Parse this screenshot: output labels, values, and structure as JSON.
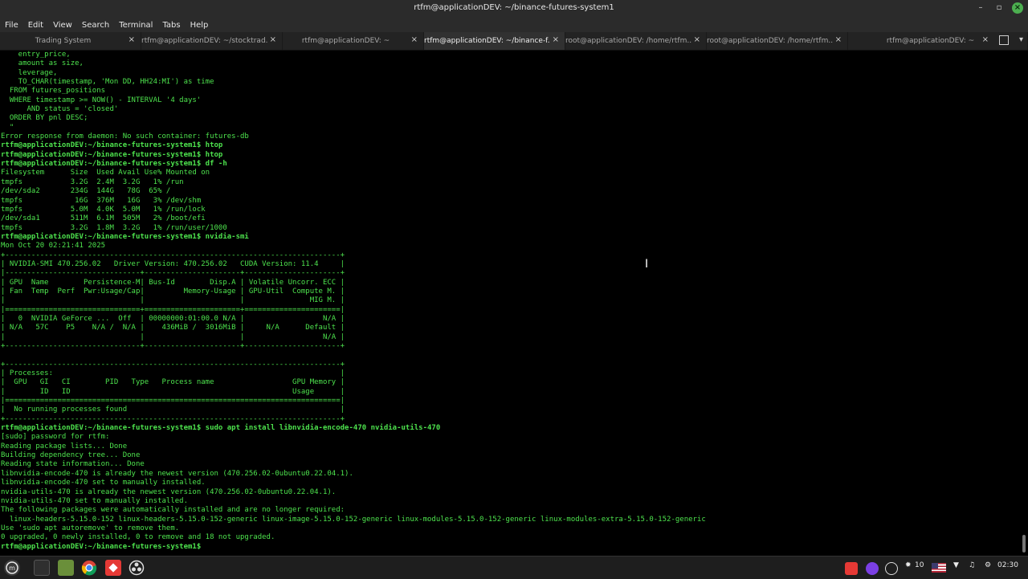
{
  "window": {
    "title": "rtfm@applicationDEV: ~/binance-futures-system1"
  },
  "menu": [
    "File",
    "Edit",
    "View",
    "Search",
    "Terminal",
    "Tabs",
    "Help"
  ],
  "tabs": [
    {
      "label": "Trading System",
      "active": false
    },
    {
      "label": "rtfm@applicationDEV: ~/stocktrad...",
      "active": false
    },
    {
      "label": "rtfm@applicationDEV: ~",
      "active": false
    },
    {
      "label": "rtfm@applicationDEV: ~/binance-f...",
      "active": true
    },
    {
      "label": "root@applicationDEV: /home/rtfm...",
      "active": false
    },
    {
      "label": "root@applicationDEV: /home/rtfm...",
      "active": false
    },
    {
      "label": "rtfm@applicationDEV: ~",
      "active": false
    }
  ],
  "terminal_lines": [
    {
      "text": "    entry_price,",
      "prompt": false
    },
    {
      "text": "    amount as size,",
      "prompt": false
    },
    {
      "text": "    leverage,",
      "prompt": false
    },
    {
      "text": "    TO_CHAR(timestamp, 'Mon DD, HH24:MI') as time",
      "prompt": false
    },
    {
      "text": "  FROM futures_positions",
      "prompt": false
    },
    {
      "text": "  WHERE timestamp >= NOW() - INTERVAL '4 days'",
      "prompt": false
    },
    {
      "text": "      AND status = 'closed'",
      "prompt": false
    },
    {
      "text": "  ORDER BY pnl DESC;",
      "prompt": false
    },
    {
      "text": "  \"",
      "prompt": false
    },
    {
      "text": "Error response from daemon: No such container: futures-db",
      "prompt": false
    },
    {
      "text": "rtfm@applicationDEV:~/binance-futures-system1$ htop",
      "prompt": true
    },
    {
      "text": "rtfm@applicationDEV:~/binance-futures-system1$ htop",
      "prompt": true
    },
    {
      "text": "rtfm@applicationDEV:~/binance-futures-system1$ df -h",
      "prompt": true
    },
    {
      "text": "Filesystem      Size  Used Avail Use% Mounted on",
      "prompt": false
    },
    {
      "text": "tmpfs           3.2G  2.4M  3.2G   1% /run",
      "prompt": false
    },
    {
      "text": "/dev/sda2       234G  144G   78G  65% /",
      "prompt": false
    },
    {
      "text": "tmpfs            16G  376M   16G   3% /dev/shm",
      "prompt": false
    },
    {
      "text": "tmpfs           5.0M  4.0K  5.0M   1% /run/lock",
      "prompt": false
    },
    {
      "text": "/dev/sda1       511M  6.1M  505M   2% /boot/efi",
      "prompt": false
    },
    {
      "text": "tmpfs           3.2G  1.8M  3.2G   1% /run/user/1000",
      "prompt": false
    },
    {
      "text": "rtfm@applicationDEV:~/binance-futures-system1$ nvidia-smi",
      "prompt": true
    },
    {
      "text": "Mon Oct 20 02:21:41 2025",
      "prompt": false
    },
    {
      "text": "+-----------------------------------------------------------------------------+",
      "prompt": false
    },
    {
      "text": "| NVIDIA-SMI 470.256.02   Driver Version: 470.256.02   CUDA Version: 11.4     |",
      "prompt": false
    },
    {
      "text": "|-------------------------------+----------------------+----------------------+",
      "prompt": false
    },
    {
      "text": "| GPU  Name        Persistence-M| Bus-Id        Disp.A | Volatile Uncorr. ECC |",
      "prompt": false
    },
    {
      "text": "| Fan  Temp  Perf  Pwr:Usage/Cap|         Memory-Usage | GPU-Util  Compute M. |",
      "prompt": false
    },
    {
      "text": "|                               |                      |               MIG M. |",
      "prompt": false
    },
    {
      "text": "|===============================+======================+======================|",
      "prompt": false
    },
    {
      "text": "|   0  NVIDIA GeForce ...  Off  | 00000000:01:00.0 N/A |                  N/A |",
      "prompt": false
    },
    {
      "text": "| N/A   57C    P5    N/A /  N/A |    436MiB /  3016MiB |     N/A      Default |",
      "prompt": false
    },
    {
      "text": "|                               |                      |                  N/A |",
      "prompt": false
    },
    {
      "text": "+-------------------------------+----------------------+----------------------+",
      "prompt": false
    },
    {
      "text": "",
      "prompt": false
    },
    {
      "text": "+-----------------------------------------------------------------------------+",
      "prompt": false
    },
    {
      "text": "| Processes:                                                                  |",
      "prompt": false
    },
    {
      "text": "|  GPU   GI   CI        PID   Type   Process name                  GPU Memory |",
      "prompt": false
    },
    {
      "text": "|        ID   ID                                                   Usage      |",
      "prompt": false
    },
    {
      "text": "|=============================================================================|",
      "prompt": false
    },
    {
      "text": "|  No running processes found                                                 |",
      "prompt": false
    },
    {
      "text": "+-----------------------------------------------------------------------------+",
      "prompt": false
    },
    {
      "text": "rtfm@applicationDEV:~/binance-futures-system1$ sudo apt install libnvidia-encode-470 nvidia-utils-470",
      "prompt": true
    },
    {
      "text": "[sudo] password for rtfm:",
      "prompt": false
    },
    {
      "text": "Reading package lists... Done",
      "prompt": false
    },
    {
      "text": "Building dependency tree... Done",
      "prompt": false
    },
    {
      "text": "Reading state information... Done",
      "prompt": false
    },
    {
      "text": "libnvidia-encode-470 is already the newest version (470.256.02-0ubuntu0.22.04.1).",
      "prompt": false
    },
    {
      "text": "libnvidia-encode-470 set to manually installed.",
      "prompt": false
    },
    {
      "text": "nvidia-utils-470 is already the newest version (470.256.02-0ubuntu0.22.04.1).",
      "prompt": false
    },
    {
      "text": "nvidia-utils-470 set to manually installed.",
      "prompt": false
    },
    {
      "text": "The following packages were automatically installed and are no longer required:",
      "prompt": false
    },
    {
      "text": "  linux-headers-5.15.0-152 linux-headers-5.15.0-152-generic linux-image-5.15.0-152-generic linux-modules-5.15.0-152-generic linux-modules-extra-5.15.0-152-generic",
      "prompt": false
    },
    {
      "text": "Use 'sudo apt autoremove' to remove them.",
      "prompt": false
    },
    {
      "text": "0 upgraded, 0 newly installed, 0 to remove and 18 not upgraded.",
      "prompt": false
    },
    {
      "text": "rtfm@applicationDEV:~/binance-futures-system1$ ",
      "prompt": true
    }
  ],
  "taskbar": {
    "apps": [
      "menu-icon",
      "terminal-icon",
      "files-icon",
      "chrome-icon",
      "anydesk-icon",
      "obs-icon"
    ],
    "tray": {
      "brightness": "10",
      "time": "02:30"
    }
  },
  "colors": {
    "terminal_fg": "#4de24d",
    "terminal_bg": "#000000",
    "accent_close": "#4caf50"
  }
}
